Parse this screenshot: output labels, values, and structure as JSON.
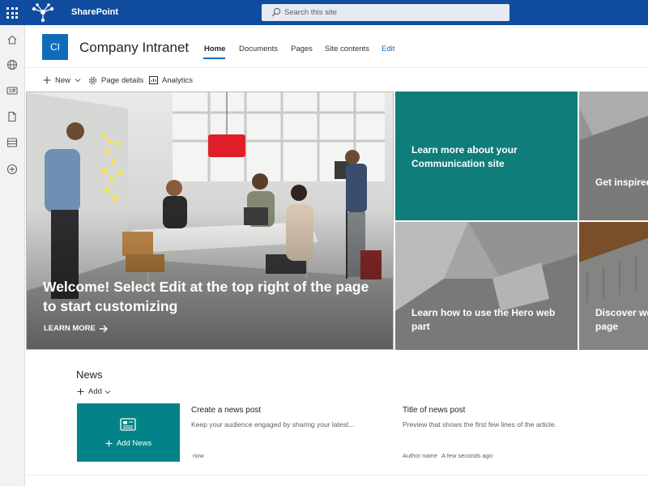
{
  "suitebar": {
    "brand": "SharePoint",
    "search_placeholder": "Search this site"
  },
  "site": {
    "logo_initials": "CI",
    "title": "Company Intranet",
    "nav": [
      {
        "label": "Home",
        "active": true
      },
      {
        "label": "Documents"
      },
      {
        "label": "Pages"
      },
      {
        "label": "Site contents"
      },
      {
        "label": "Edit"
      }
    ]
  },
  "commands": {
    "new": "New",
    "page_details": "Page details",
    "analytics": "Analytics"
  },
  "hero": {
    "main_title": "Welcome! Select Edit at the top right of the page to start customizing",
    "main_cta": "LEARN MORE",
    "tiles": [
      {
        "label": "Learn more about your Communication site"
      },
      {
        "label": "Get inspired with SharePoint"
      },
      {
        "label": "Learn how to use the Hero web part"
      },
      {
        "label": "Discover web parts to add to this page"
      }
    ]
  },
  "news": {
    "title": "News",
    "add_label": "Add",
    "card_label": "Add News",
    "posts": [
      {
        "title": "Create a news post",
        "desc": "Keep your audience engaged by sharing your latest...",
        "time": "now",
        "author": ""
      },
      {
        "title": "Title of news post",
        "desc": "Preview that shows the first few lines of the article.",
        "author": "Author name",
        "time": "A few seconds ago"
      }
    ]
  },
  "colors": {
    "suitebar": "#0f4c9e",
    "accent": "#0f6cbd",
    "teal": "#038387"
  }
}
